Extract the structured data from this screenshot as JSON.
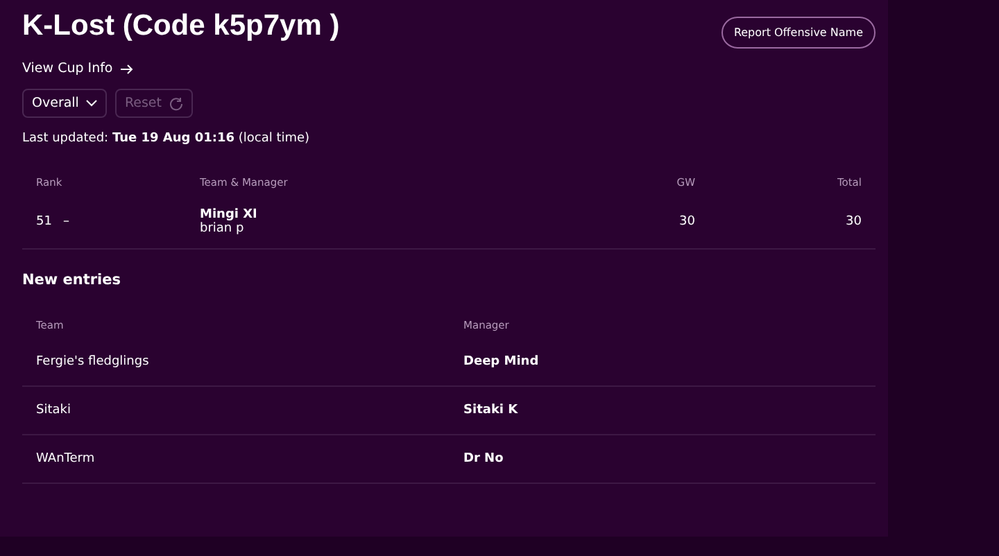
{
  "title": "K-Lost (Code k5p7ym )",
  "report_button": "Report Offensive Name",
  "cup_link": "View Cup Info",
  "filter": {
    "label": "Overall"
  },
  "reset": {
    "label": "Reset",
    "disabled": true
  },
  "last_updated": "Last updated: **Tue 19 Aug 01:16** (local time)",
  "standings": {
    "columns": [
      "Rank",
      "Team & Manager",
      "GW",
      "Total"
    ],
    "rows": [
      {
        "rank": "51",
        "movement": "–",
        "team": "Mingi XI",
        "manager": "brian p",
        "gw": "30",
        "total": "30"
      }
    ]
  },
  "new_entries": {
    "heading": "New entries",
    "columns": [
      "Team",
      "Manager"
    ],
    "rows": [
      {
        "team": "Fergie's fledglings",
        "manager": "Deep Mind"
      },
      {
        "team": "Sitaki",
        "manager": "Sitaki K"
      },
      {
        "team": "WAnTerm",
        "manager": "Dr No"
      }
    ]
  }
}
